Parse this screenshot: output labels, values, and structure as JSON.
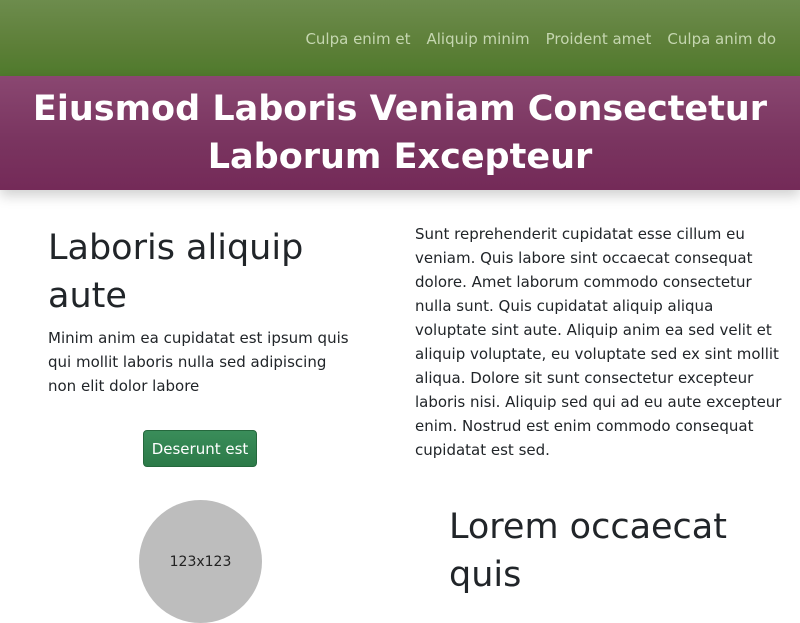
{
  "nav": {
    "items": [
      {
        "label": "Culpa enim et"
      },
      {
        "label": "Aliquip minim"
      },
      {
        "label": "Proident amet"
      },
      {
        "label": "Culpa anim do"
      }
    ]
  },
  "banner": {
    "title": "Eiusmod Laboris Veniam Consectetur Laborum Excepteur"
  },
  "left_section": {
    "heading": "Laboris aliquip aute",
    "text": "Minim anim ea cupidatat est ipsum quis qui mollit laboris nulla sed adipiscing non elit dolor labore",
    "button_label": "Deserunt est"
  },
  "right_section": {
    "text": "Sunt reprehenderit cupidatat esse cillum eu veniam. Quis labore sint occaecat consequat dolore. Amet laborum commodo consectetur nulla sunt. Quis cupidatat aliquip aliqua voluptate sint aute. Aliquip anim ea sed velit et aliquip voluptate, eu voluptate sed ex sint mollit aliqua. Dolore sit sunt consectetur excepteur laboris nisi. Aliquip sed qui ad eu aute excepteur enim. Nostrud est enim commodo consequat cupidatat est sed."
  },
  "image_placeholder": {
    "label": "123x123"
  },
  "second_section": {
    "heading": "Lorem occaecat quis"
  }
}
